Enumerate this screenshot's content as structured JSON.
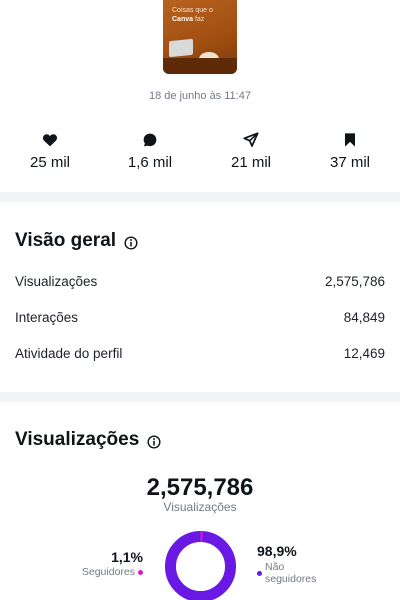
{
  "post": {
    "thumbnail_caption_prefix": "Coisas que o",
    "thumbnail_caption_brand": "Canva",
    "thumbnail_caption_suffix": "faz",
    "timestamp": "18 de junho às 11:47"
  },
  "stats": [
    {
      "icon": "heart-icon",
      "value": "25 mil"
    },
    {
      "icon": "comment-icon",
      "value": "1,6 mil"
    },
    {
      "icon": "share-icon",
      "value": "21 mil"
    },
    {
      "icon": "bookmark-icon",
      "value": "37 mil"
    }
  ],
  "overview": {
    "title": "Visão geral",
    "rows": [
      {
        "label": "Visualizações",
        "value": "2,575,786"
      },
      {
        "label": "Interações",
        "value": "84,849"
      },
      {
        "label": "Atividade do perfil",
        "value": "12,469"
      }
    ]
  },
  "views": {
    "title": "Visualizações",
    "total": "2,575,786",
    "total_label": "Visualizações",
    "followers": {
      "percent": "1,1%",
      "label": "Seguidores",
      "fraction": 0.011,
      "color": "#d21ec8"
    },
    "non_followers": {
      "percent": "98,9%",
      "label": "Não seguidores",
      "fraction": 0.989,
      "color": "#6a18e3"
    }
  }
}
